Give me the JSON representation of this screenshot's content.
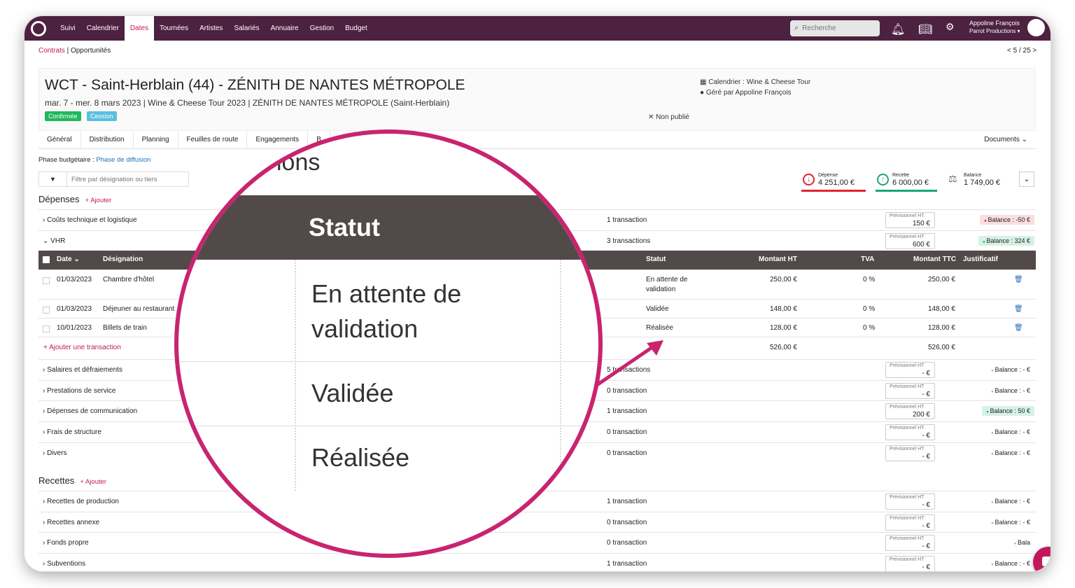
{
  "nav": {
    "items": [
      "Suivi",
      "Calendrier",
      "Dates",
      "Tournées",
      "Artistes",
      "Salariés",
      "Annuaire",
      "Gestion",
      "Budget"
    ],
    "active": "Dates",
    "search_placeholder": "Recherche",
    "user_name": "Appoline François",
    "user_company": "Parrot Productions"
  },
  "breadcrumb": {
    "first": "Contrats",
    "sep": " | ",
    "second": "Opportunités"
  },
  "pager": "< 5 / 25 >",
  "event": {
    "title": "WCT - Saint-Herblain (44) - ZÉNITH DE NANTES MÉTROPOLE",
    "subtitle": "mar. 7 - mer. 8 mars 2023 | Wine & Cheese Tour 2023 | ZÉNITH DE NANTES MÉTROPOLE (Saint-Herblain)",
    "badge1": "Confirmée",
    "badge2": "Cession",
    "calendar": "Calendrier : Wine & Cheese Tour",
    "managed_by": "Géré par Appoline François",
    "publish": "Non publié"
  },
  "tabs": [
    "Général",
    "Distribution",
    "Planning",
    "Feuilles de route",
    "Engagements",
    "B"
  ],
  "documents": "Documents",
  "phase": {
    "label": "Phase budgétaire : ",
    "value": "Phase de diffusion"
  },
  "filter_placeholder": "Filtre par désignation ou tiers",
  "kpi": {
    "depense_label": "Dépense",
    "depense": "4 251,00 €",
    "recette_label": "Recette",
    "recette": "6 000,00 €",
    "balance_label": "Balance",
    "balance": "1 749,00 €"
  },
  "colors": {
    "nav": "#4d2140",
    "accent": "#c2185b",
    "red": "#e0252f",
    "green": "#1aa774"
  },
  "depenses": {
    "title": "Dépenses",
    "add": "+ Ajouter"
  },
  "recettes": {
    "title": "Recettes",
    "add": "+ Ajouter"
  },
  "prev_label": "Prévisionnel HT",
  "rows_top": [
    {
      "label": "Coûts technique et logistique",
      "count": "1 transaction",
      "prev": "150  €",
      "balance": "Balance : -50 €",
      "type": "neg"
    },
    {
      "label": "VHR",
      "count": "3 transactions",
      "prev": "600  €",
      "balance": "Balance : 324 €",
      "type": "pos"
    }
  ],
  "table": {
    "headers": {
      "date": "Date",
      "designation": "Désignation",
      "statut": "Statut",
      "ht": "Montant HT",
      "tva": "TVA",
      "ttc": "Montant TTC",
      "just": "Justificatif"
    },
    "rows": [
      {
        "date": "01/03/2023",
        "designation": "Chambre d'hôtel",
        "statut": "En attente de validation",
        "ht": "250,00 €",
        "tva": "0 %",
        "ttc": "250,00 €"
      },
      {
        "date": "01/03/2023",
        "designation": "Déjeuner au restaurant",
        "statut": "Validée",
        "ht": "148,00 €",
        "tva": "0 %",
        "ttc": "148,00 €"
      },
      {
        "date": "10/01/2023",
        "designation": "Billets de train",
        "statut": "Réalisée",
        "ht": "128,00 €",
        "tva": "0 %",
        "ttc": "128,00 €"
      }
    ],
    "total_ht": "526,00 €",
    "total_ttc": "526,00 €",
    "add": "+ Ajouter une transaction"
  },
  "rows_mid": [
    {
      "label": "Salaires et défraiements",
      "count": "5 transactions",
      "prev": "-  €",
      "balance": "Balance : - €",
      "type": "none"
    },
    {
      "label": "Prestations de service",
      "count": "0 transaction",
      "prev": "-  €",
      "balance": "Balance : - €",
      "type": "none"
    },
    {
      "label": "Dépenses de communication",
      "count": "1 transaction",
      "prev": "200  €",
      "balance": "Balance : 50 €",
      "type": "pos"
    },
    {
      "label": "Frais de structure",
      "count": "0 transaction",
      "prev": "-  €",
      "balance": "Balance : - €",
      "type": "none"
    },
    {
      "label": "Divers",
      "count": "0 transaction",
      "prev": "-  €",
      "balance": "Balance : - €",
      "type": "none"
    }
  ],
  "rows_rec": [
    {
      "label": "Recettes de production",
      "count": "1 transaction",
      "prev": "-  €",
      "balance": "Balance : - €",
      "type": "none"
    },
    {
      "label": "Recettes annexe",
      "count": "0 transaction",
      "prev": "-  €",
      "balance": "Balance : - €",
      "type": "none"
    },
    {
      "label": "Fonds propre",
      "count": "0 transaction",
      "prev": "-  €",
      "balance": "Bala",
      "type": "none"
    },
    {
      "label": "Subventions",
      "count": "1 transaction",
      "prev": "-  €",
      "balance": "Balance : - €",
      "type": "none"
    }
  ],
  "magnifier": {
    "partial": "ions",
    "header": "Statut",
    "s1a": "En attente de",
    "s1b": "validation",
    "s2": "Validée",
    "s3": "Réalisée"
  }
}
